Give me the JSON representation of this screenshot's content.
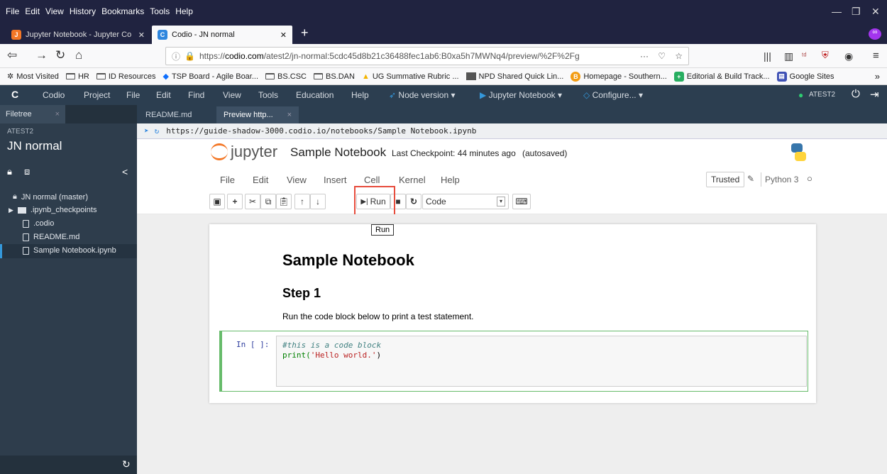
{
  "firefox_menu": [
    "File",
    "Edit",
    "View",
    "History",
    "Bookmarks",
    "Tools",
    "Help"
  ],
  "browser_tabs": [
    {
      "title": "Jupyter Notebook - Jupyter Co",
      "favicon": "jupyter-icon",
      "active": false
    },
    {
      "title": "Codio - JN normal",
      "favicon": "codio-icon",
      "active": true
    }
  ],
  "url": {
    "prefix": "https://",
    "domain": "codio.com",
    "path": "/atest2/jn-normal:5cdc45d8b21c36488fec1ab6:B0xa5h7MWNq4/preview/%2F%2Fg",
    "more": "···"
  },
  "bookmarks": [
    {
      "label": "Most Visited",
      "icon": "gear-icon"
    },
    {
      "label": "HR",
      "icon": "folder-icon"
    },
    {
      "label": "ID Resources",
      "icon": "folder-icon"
    },
    {
      "label": "TSP Board - Agile Boar...",
      "icon": "diamond-icon"
    },
    {
      "label": "BS.CSC",
      "icon": "folder-icon"
    },
    {
      "label": "BS.DAN",
      "icon": "folder-icon"
    },
    {
      "label": "UG Summative Rubric ...",
      "icon": "drive-icon"
    },
    {
      "label": "NPD Shared Quick Lin...",
      "icon": "image-icon"
    },
    {
      "label": "Homepage - Southern...",
      "icon": "circle-b-icon"
    },
    {
      "label": "Editorial & Build Track...",
      "icon": "green-plus-icon"
    },
    {
      "label": "Google Sites",
      "icon": "sites-icon"
    }
  ],
  "codio_menu": {
    "logo": "C",
    "items": [
      "Codio",
      "Project",
      "File",
      "Edit",
      "Find",
      "View",
      "Tools",
      "Education",
      "Help"
    ],
    "node_version": "Node version",
    "jupyter": "Jupyter Notebook",
    "configure": "Configure...",
    "user": "ATEST2"
  },
  "sidebar": {
    "tab": "Filetree",
    "workspace": "ATEST2",
    "project": "JN normal",
    "tree": [
      {
        "label": "JN normal (master)",
        "icon": "lock-icon"
      },
      {
        "label": ".ipynb_checkpoints",
        "icon": "folder-icon"
      },
      {
        "label": ".codio",
        "icon": "file-icon"
      },
      {
        "label": "README.md",
        "icon": "file-icon"
      },
      {
        "label": "Sample Notebook.ipynb",
        "icon": "file-icon",
        "selected": true
      }
    ]
  },
  "editor_tabs": [
    {
      "label": "README.md",
      "active": false
    },
    {
      "label": "Preview http...",
      "active": true
    }
  ],
  "preview_url": "https://guide-shadow-3000.codio.io/notebooks/Sample Notebook.ipynb",
  "jupyter": {
    "logo": "jupyter",
    "notebook_name": "Sample Notebook",
    "checkpoint": "Last Checkpoint: 44 minutes ago",
    "autosaved": "(autosaved)",
    "menu": [
      "File",
      "Edit",
      "View",
      "Insert",
      "Cell",
      "Kernel",
      "Help"
    ],
    "trusted": "Trusted",
    "kernel": "Python 3",
    "run_label": "Run",
    "cell_type": "Code",
    "tooltip": "Run"
  },
  "notebook": {
    "h1": "Sample Notebook",
    "h2": "Step 1",
    "paragraph": "Run the code block below to print a test statement.",
    "prompt": "In [ ]:",
    "code_comment": "#this is a code block",
    "code_fn": "print(",
    "code_str": "'Hello world.'",
    "code_end": ")"
  },
  "colors": {
    "browser_frame": "#202340",
    "codio_bar": "#2c3e50",
    "sidebar": "#2e3d4c",
    "highlight": "#e74c3c",
    "cell_border": "#66bb6a"
  }
}
